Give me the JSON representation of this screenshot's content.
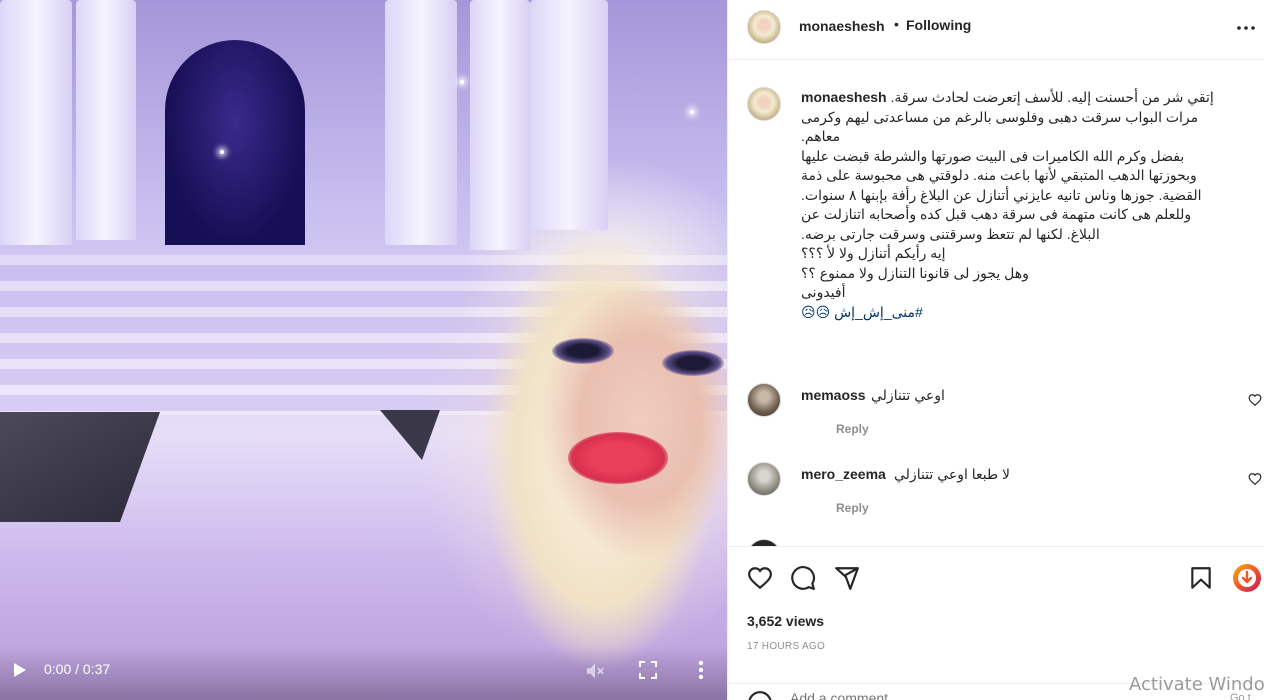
{
  "video": {
    "time": "0:00 / 0:37"
  },
  "header": {
    "username": "monaeshesh",
    "separator": "•",
    "follow_status": "Following"
  },
  "caption": {
    "username": "monaeshesh",
    "lines": [
      "إتقي شر من أحسنت إليه. للأسف إتعرضت لحادث سرقة.",
      "مرات البواب سرقت دهبى وفلوسى بالرغم من مساعدتى ليهم وكرمى",
      "معاهم.",
      "بفضل وكرم الله الكاميرات فى البيت صورتها والشرطة قبضت عليها",
      "وبحوزتها الدهب المتبقي لأنها باعت منه. دلوقتي هى محبوسة على ذمة",
      "القضية. جوزها وناس تانيه عايزني أتنازل عن البلاغ رأفة بإبنها ٨ سنوات.",
      "وللعلم هى كانت متهمة فى سرقة دهب قبل كده وأصحابه اتنازلت عن",
      "البلاغ. لكنها لم تتعظ وسرقتنى وسرقت جارتى برضه.",
      "إيه رأيكم أتنازل ولا لأ ؟؟؟",
      "وهل يجوز لى قانونا التنازل ولا ممنوع ؟؟",
      "أفيدونى"
    ],
    "hashtag_line": "#منى_إش_إش 😥😥"
  },
  "comments": [
    {
      "username": "memaoss",
      "text": "اوعي تتنازلي",
      "reply_label": "Reply"
    },
    {
      "username": "mero_zeema",
      "text": "لا طبعا اوعي تتنازلي",
      "reply_label": "Reply"
    }
  ],
  "stats": {
    "views": "3,652 views",
    "time_ago": "17 HOURS AGO"
  },
  "add_comment": {
    "placeholder": "Add a comment..."
  },
  "watermark": {
    "line1": "Activate Windo",
    "line2": "Go t"
  }
}
